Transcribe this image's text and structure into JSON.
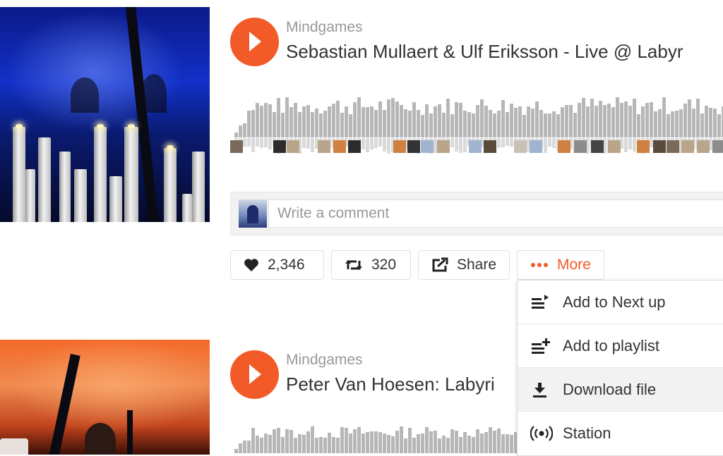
{
  "tracks": [
    {
      "uploader": "Mindgames",
      "title": "Sebastian Mullaert & Ulf Eriksson - Live @ Labyr",
      "actions": {
        "like_count": "2,346",
        "repost_count": "320",
        "share_label": "Share",
        "more_label": "More"
      }
    },
    {
      "uploader": "Mindgames",
      "title": "Peter Van Hoesen: Labyri"
    }
  ],
  "comment": {
    "placeholder": "Write a comment"
  },
  "more_menu": {
    "items": [
      {
        "label": "Add to Next up",
        "icon": "add-to-next-up-icon"
      },
      {
        "label": "Add to playlist",
        "icon": "add-to-playlist-icon"
      },
      {
        "label": "Download file",
        "icon": "download-icon"
      },
      {
        "label": "Station",
        "icon": "station-icon"
      }
    ]
  },
  "colors": {
    "accent": "#f25b28",
    "waveform": "#b7b7b7"
  }
}
